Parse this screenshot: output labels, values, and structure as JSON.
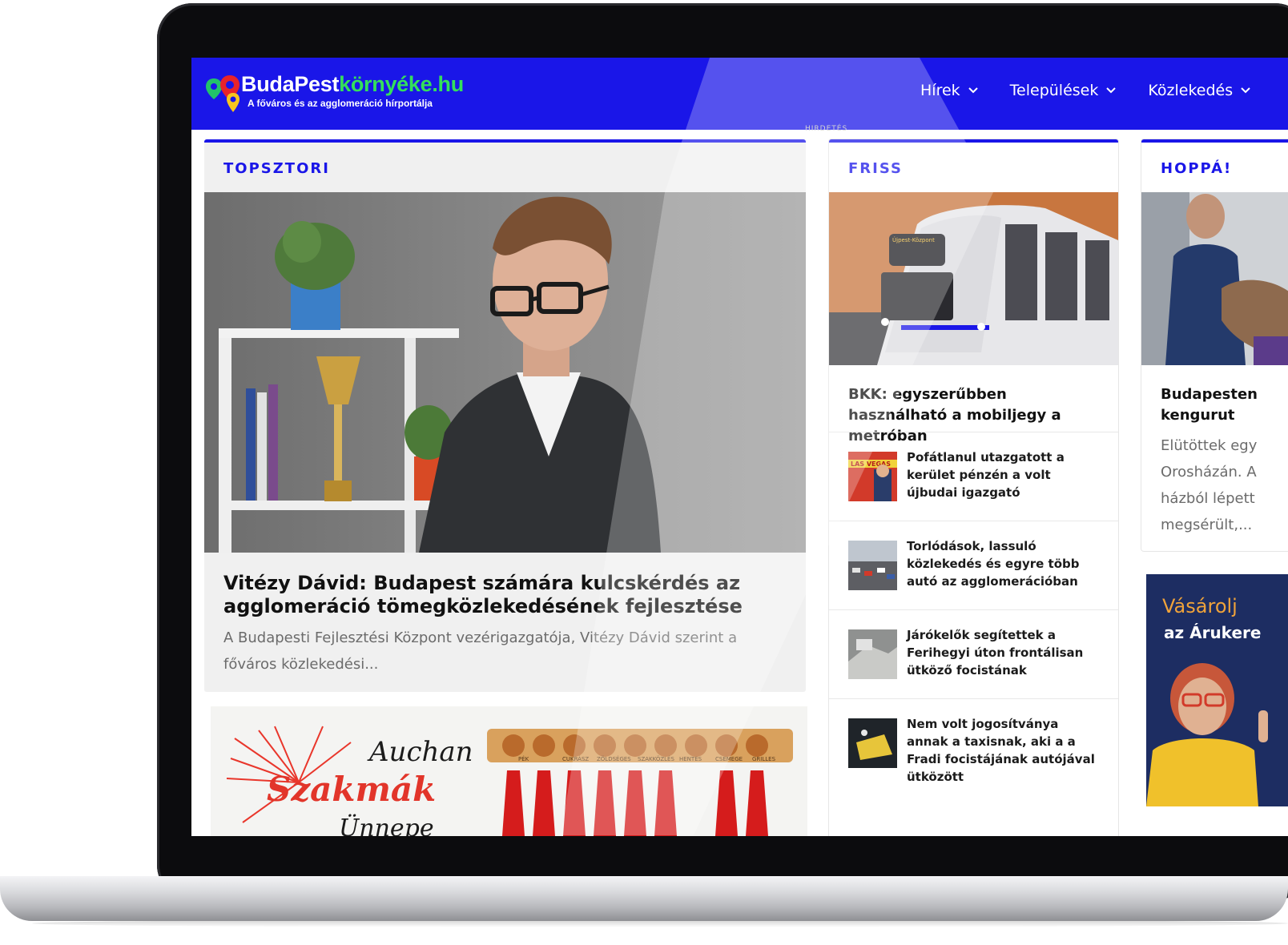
{
  "site": {
    "logo_part1": "BudaPest",
    "logo_part2": "környéke.hu",
    "tagline": "A főváros és az agglomeráció hírportálja",
    "brand_color": "#1a16e8",
    "accent_color": "#34e05b"
  },
  "nav": {
    "items": [
      {
        "label": "Hírek"
      },
      {
        "label": "Települések"
      },
      {
        "label": "Közlekedés"
      }
    ]
  },
  "ad_label": "HIRDETÉS",
  "topsztori": {
    "section_title": "TOPSZTORI",
    "headline": "Vitézy Dávid: Budapest számára kulcskérdés az agglomeráció tömegközlekedésének fejlesztése",
    "excerpt": "A Budapesti Fejlesztési Központ vezérigazgatója, Vitézy Dávid szerint a főváros közlekedési..."
  },
  "banner": {
    "brand": "Auchan",
    "line1": "Szakmák",
    "line2": "Ünnepe",
    "hook_labels": [
      "PÉK",
      "CUKRÁSZ",
      "ZÖLDSÉGES",
      "SZAKKÖZLÉS",
      "HENTES",
      "CSEMEGE",
      "GRILLES"
    ]
  },
  "friss": {
    "section_title": "FRISS",
    "train_sign": "Újpest-Központ",
    "headline": "BKK: egyszerűbben használható a mobiljegy a metróban",
    "items": [
      {
        "title": "Pofátlanul utazgatott a kerület pénzén a volt újbudai igazgató",
        "thumb_text": "LAS VEGAS"
      },
      {
        "title": "Torlódások, lassuló közlekedés és egyre több autó az agglomerációban"
      },
      {
        "title": "Járókelők segítettek a Ferihegyi úton frontálisan ütköző focistának"
      },
      {
        "title": "Nem volt jogosítványa annak a taxisnak, aki a a Fradi focistájának autójával ütközött"
      }
    ]
  },
  "hoppa": {
    "section_title": "HOPPÁ!",
    "headline_line1": "Budapesten",
    "headline_line2": "kengurut",
    "excerpt_lines": [
      "Elütöttek egy",
      "Orosházán. A",
      "házból lépett",
      "megsérült,..."
    ]
  },
  "ad_side": {
    "line1": "Vásárolj",
    "line2": "az Árukere"
  }
}
